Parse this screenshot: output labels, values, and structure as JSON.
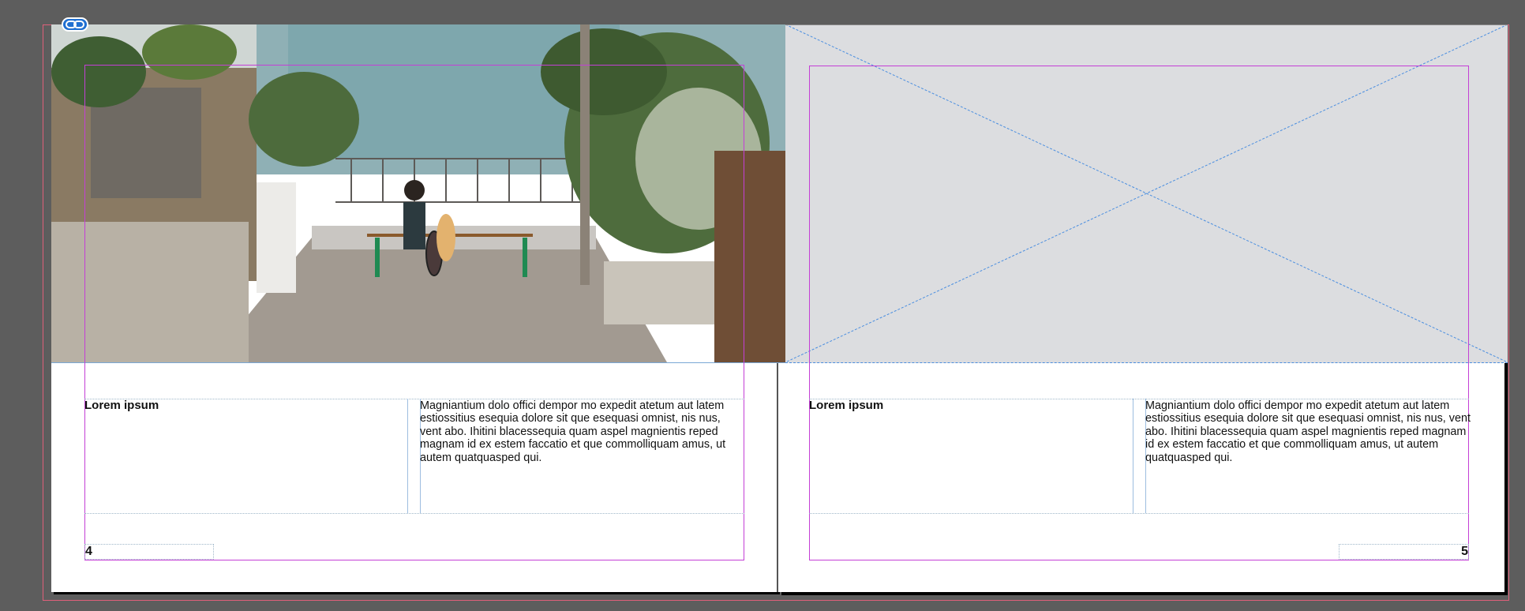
{
  "document": {
    "colors": {
      "pasteboard": "#5d5d5d",
      "bleed_guide": "#e0607a",
      "margin_guide": "#c43fd6",
      "frame_edge": "#7aa7d6",
      "placeholder_fill": "#dcdde0",
      "placeholder_cross": "#4a8ee0"
    },
    "link_icon": "link-icon"
  },
  "left_page": {
    "heading": "Lorem ipsum",
    "body": "Magniantium dolo offici dempor mo expedit atetum aut latem estiossitius esequia dolore sit que esequasi omnist, nis nus, vent abo. Ihitini blacessequia quam aspel magnientis reped magnam id ex estem faccatio et que commolliquam amus, ut autem quatquasped qui.",
    "page_number": "4"
  },
  "right_page": {
    "heading": "Lorem ipsum",
    "body": "Magniantium dolo offici dempor mo expedit atetum aut latem estiossitius esequia dolore sit que esequasi omnist, nis nus, vent abo. Ihitini blacessequia quam aspel magnientis reped magnam id ex estem faccatio et que commolliquam amus, ut autem quatquasped qui.",
    "page_number": "5"
  }
}
